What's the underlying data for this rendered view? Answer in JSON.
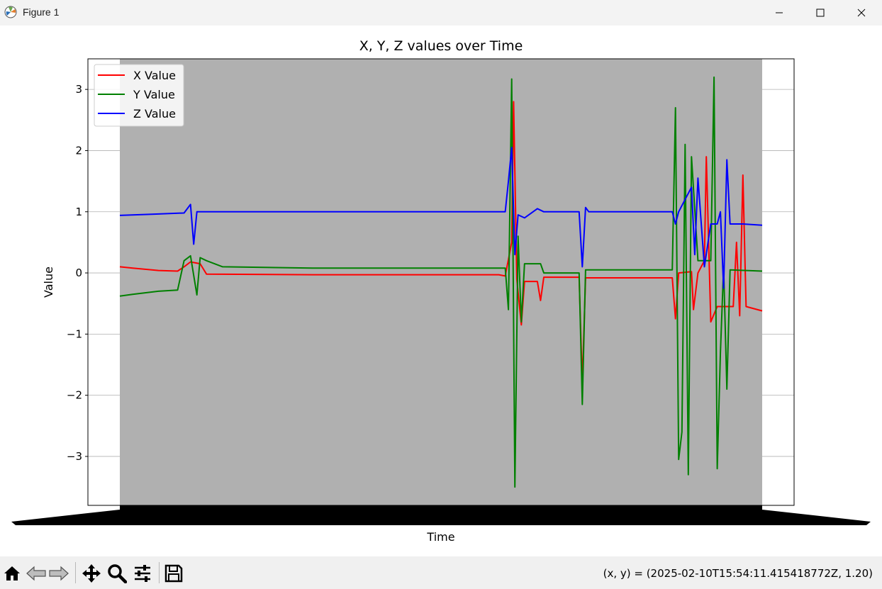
{
  "window": {
    "title": "Figure 1"
  },
  "toolbar": {
    "buttons": [
      "home-icon",
      "back-icon",
      "forward-icon",
      "pan-icon",
      "zoom-icon",
      "configure-icon",
      "save-icon"
    ],
    "coords": "(x, y) = (2025-02-10T15:54:11.415418772Z, 1.20)"
  },
  "colors": {
    "background": "#b0b0b0",
    "x": "#ff0000",
    "y": "#008000",
    "z": "#0000ff"
  },
  "chart_data": {
    "type": "line",
    "title": "X, Y, Z values over Time",
    "xlabel": "Time",
    "ylabel": "Value",
    "ylim": [
      -3.8,
      3.5
    ],
    "yticks": [
      -3,
      -2,
      -1,
      0,
      1,
      2,
      3
    ],
    "ytick_labels": [
      "−3",
      "−2",
      "−1",
      "0",
      "1",
      "2",
      "3"
    ],
    "grid": "y",
    "legend": "top-left",
    "x_tick_labels": "overlapping timestamp labels (unreadable)",
    "series": [
      {
        "name": "X Value",
        "color": "#ff0000",
        "points": [
          [
            0,
            0.1
          ],
          [
            0.02,
            0.08
          ],
          [
            0.06,
            0.04
          ],
          [
            0.09,
            0.03
          ],
          [
            0.1,
            0.1
          ],
          [
            0.11,
            0.18
          ],
          [
            0.125,
            0.15
          ],
          [
            0.135,
            -0.02
          ],
          [
            0.3,
            -0.03
          ],
          [
            0.59,
            -0.03
          ],
          [
            0.6,
            -0.05
          ],
          [
            0.61,
            0.5
          ],
          [
            0.613,
            2.8
          ],
          [
            0.618,
            -0.1
          ],
          [
            0.625,
            -0.85
          ],
          [
            0.63,
            -0.14
          ],
          [
            0.65,
            -0.14
          ],
          [
            0.655,
            -0.45
          ],
          [
            0.66,
            -0.07
          ],
          [
            0.715,
            -0.07
          ],
          [
            0.72,
            -1.8
          ],
          [
            0.725,
            -0.08
          ],
          [
            0.86,
            -0.08
          ],
          [
            0.865,
            -0.75
          ],
          [
            0.87,
            0.0
          ],
          [
            0.89,
            0.02
          ],
          [
            0.893,
            -0.6
          ],
          [
            0.9,
            0.0
          ],
          [
            0.91,
            0.2
          ],
          [
            0.913,
            1.9
          ],
          [
            0.92,
            -0.8
          ],
          [
            0.93,
            -0.55
          ],
          [
            0.955,
            -0.55
          ],
          [
            0.96,
            0.5
          ],
          [
            0.965,
            -0.7
          ],
          [
            0.97,
            1.6
          ],
          [
            0.975,
            -0.55
          ],
          [
            1.0,
            -0.62
          ]
        ]
      },
      {
        "name": "Y Value",
        "color": "#008000",
        "points": [
          [
            0,
            -0.38
          ],
          [
            0.02,
            -0.35
          ],
          [
            0.06,
            -0.3
          ],
          [
            0.09,
            -0.28
          ],
          [
            0.1,
            0.2
          ],
          [
            0.11,
            0.28
          ],
          [
            0.12,
            -0.36
          ],
          [
            0.125,
            0.25
          ],
          [
            0.135,
            0.2
          ],
          [
            0.16,
            0.1
          ],
          [
            0.3,
            0.08
          ],
          [
            0.6,
            0.08
          ],
          [
            0.605,
            -0.6
          ],
          [
            0.61,
            3.17
          ],
          [
            0.615,
            -3.5
          ],
          [
            0.62,
            0.6
          ],
          [
            0.625,
            -0.8
          ],
          [
            0.63,
            0.15
          ],
          [
            0.655,
            0.15
          ],
          [
            0.66,
            0.0
          ],
          [
            0.715,
            0.0
          ],
          [
            0.72,
            -2.15
          ],
          [
            0.725,
            0.05
          ],
          [
            0.86,
            0.05
          ],
          [
            0.865,
            2.7
          ],
          [
            0.87,
            -3.05
          ],
          [
            0.875,
            -2.6
          ],
          [
            0.88,
            2.1
          ],
          [
            0.885,
            -3.3
          ],
          [
            0.89,
            1.9
          ],
          [
            0.9,
            0.2
          ],
          [
            0.92,
            0.2
          ],
          [
            0.925,
            3.2
          ],
          [
            0.93,
            -3.2
          ],
          [
            0.935,
            -1.3
          ],
          [
            0.94,
            0.1
          ],
          [
            0.945,
            -1.9
          ],
          [
            0.95,
            0.05
          ],
          [
            1.0,
            0.03
          ]
        ]
      },
      {
        "name": "Z Value",
        "color": "#0000ff",
        "points": [
          [
            0,
            0.94
          ],
          [
            0.05,
            0.96
          ],
          [
            0.1,
            0.98
          ],
          [
            0.11,
            1.12
          ],
          [
            0.115,
            0.47
          ],
          [
            0.12,
            1.0
          ],
          [
            0.3,
            1.0
          ],
          [
            0.6,
            1.0
          ],
          [
            0.605,
            1.5
          ],
          [
            0.61,
            2.05
          ],
          [
            0.615,
            0.3
          ],
          [
            0.62,
            0.95
          ],
          [
            0.63,
            0.9
          ],
          [
            0.65,
            1.05
          ],
          [
            0.66,
            1.0
          ],
          [
            0.715,
            1.0
          ],
          [
            0.72,
            0.1
          ],
          [
            0.725,
            1.07
          ],
          [
            0.73,
            1.0
          ],
          [
            0.86,
            1.0
          ],
          [
            0.865,
            0.8
          ],
          [
            0.87,
            1.0
          ],
          [
            0.89,
            1.4
          ],
          [
            0.895,
            0.3
          ],
          [
            0.9,
            1.55
          ],
          [
            0.91,
            0.1
          ],
          [
            0.92,
            0.8
          ],
          [
            0.93,
            0.8
          ],
          [
            0.935,
            1.0
          ],
          [
            0.94,
            -0.25
          ],
          [
            0.945,
            1.85
          ],
          [
            0.95,
            0.8
          ],
          [
            0.97,
            0.8
          ],
          [
            1.0,
            0.78
          ]
        ]
      }
    ]
  }
}
